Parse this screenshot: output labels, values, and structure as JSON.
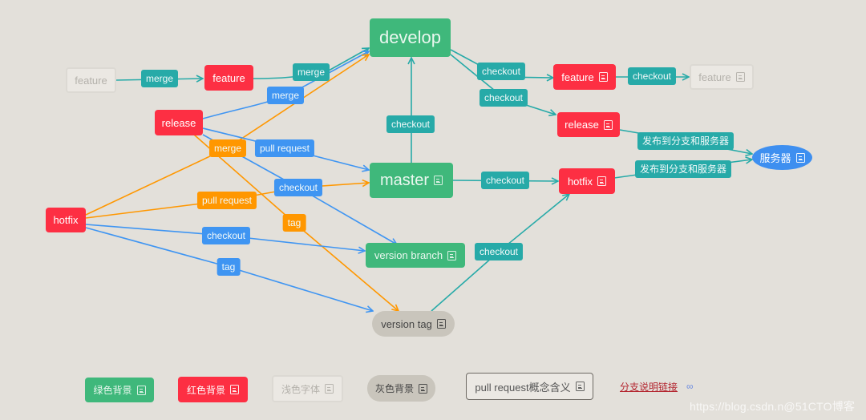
{
  "colors": {
    "background": "#e3e0da",
    "green": "#3fb87b",
    "red": "#fd2f43",
    "teal": "#27aaa8",
    "blue": "#3f95f2",
    "orange": "#ff9700",
    "gray": "#c9c5bc",
    "server_blue": "#3e8ff0"
  },
  "nodes": {
    "develop": {
      "label": "develop",
      "style": "green"
    },
    "master": {
      "label": "master",
      "style": "green",
      "note": true
    },
    "version_branch": {
      "label": "version branch",
      "style": "green",
      "note": true
    },
    "version_tag": {
      "label": "version tag",
      "style": "gray",
      "note": true
    },
    "feature_light_left": {
      "label": "feature",
      "style": "light"
    },
    "feature_red_left": {
      "label": "feature",
      "style": "red"
    },
    "release_left": {
      "label": "release",
      "style": "red"
    },
    "hotfix_left": {
      "label": "hotfix",
      "style": "red"
    },
    "feature_red_right": {
      "label": "feature",
      "style": "red",
      "note": true
    },
    "feature_light_right": {
      "label": "feature",
      "style": "light",
      "note": true
    },
    "release_right": {
      "label": "release",
      "style": "red",
      "note": true
    },
    "hotfix_right": {
      "label": "hotfix",
      "style": "red",
      "note": true
    },
    "server": {
      "label": "服务器",
      "style": "blue",
      "note": true
    }
  },
  "edges": [
    {
      "from": "feature_light_left",
      "to": "feature_red_left",
      "label": "merge",
      "color": "teal"
    },
    {
      "from": "feature_red_left",
      "to": "develop",
      "label": "merge",
      "color": "teal"
    },
    {
      "from": "release_left",
      "to": "develop",
      "label": "merge",
      "color": "blue"
    },
    {
      "from": "hotfix_left",
      "to": "develop",
      "label": "merge",
      "color": "orange"
    },
    {
      "from": "release_left",
      "to": "master",
      "label": "pull request",
      "color": "blue"
    },
    {
      "from": "hotfix_left",
      "to": "master",
      "label": "pull request",
      "color": "orange"
    },
    {
      "from": "release_left",
      "to": "version_branch",
      "label": "checkout",
      "color": "blue"
    },
    {
      "from": "release_left",
      "to": "version_tag",
      "label": "tag",
      "color": "orange"
    },
    {
      "from": "hotfix_left",
      "to": "version_branch",
      "label": "checkout",
      "color": "blue"
    },
    {
      "from": "hotfix_left",
      "to": "version_tag",
      "label": "tag",
      "color": "blue"
    },
    {
      "from": "master",
      "to": "develop",
      "label": "checkout",
      "color": "teal"
    },
    {
      "from": "develop",
      "to": "feature_red_right",
      "label": "checkout",
      "color": "teal"
    },
    {
      "from": "develop",
      "to": "release_right",
      "label": "checkout",
      "color": "teal"
    },
    {
      "from": "feature_red_right",
      "to": "feature_light_right",
      "label": "checkout",
      "color": "teal"
    },
    {
      "from": "master",
      "to": "hotfix_right",
      "label": "checkout",
      "color": "teal"
    },
    {
      "from": "version_tag",
      "to": "hotfix_right",
      "label": "checkout",
      "color": "teal"
    },
    {
      "from": "release_right",
      "to": "server",
      "label": "发布到分支和服务器",
      "color": "teal"
    },
    {
      "from": "hotfix_right",
      "to": "server",
      "label": "发布到分支和服务器",
      "color": "teal"
    }
  ],
  "legend": {
    "green": "绿色背景",
    "red": "红色背景",
    "light": "浅色字体",
    "gray": "灰色背景",
    "outline": "pull request概念含义"
  },
  "link": {
    "label": "分支说明链接",
    "icon": "link-icon"
  },
  "watermark": "https://blog.csdn.n@51CTO博客"
}
